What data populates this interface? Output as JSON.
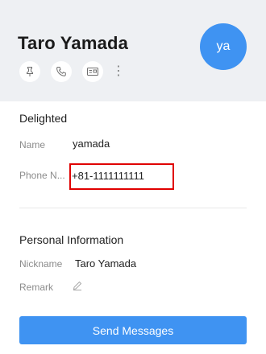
{
  "header": {
    "title": "Taro Yamada",
    "avatar_initials": "ya",
    "avatar_color": "#3f93f2",
    "actions": [
      {
        "icon": "pin-icon"
      },
      {
        "icon": "phone-icon"
      },
      {
        "icon": "contact-card-icon"
      },
      {
        "icon": "more-vertical-icon",
        "label": "⋮"
      }
    ]
  },
  "status": {
    "label": "Delighted"
  },
  "details": {
    "name_label": "Name",
    "name_value": "yamada",
    "phone_label": "Phone N...",
    "phone_value": "+81-1111111111"
  },
  "personal": {
    "section_title": "Personal Information",
    "nickname_label": "Nickname",
    "nickname_value": "Taro Yamada",
    "remark_label": "Remark",
    "remark_icon": "edit-icon"
  },
  "footer": {
    "send_label": "Send Messages",
    "send_color": "#3f93f2"
  },
  "annotation": {
    "highlight_color": "#e00000"
  }
}
